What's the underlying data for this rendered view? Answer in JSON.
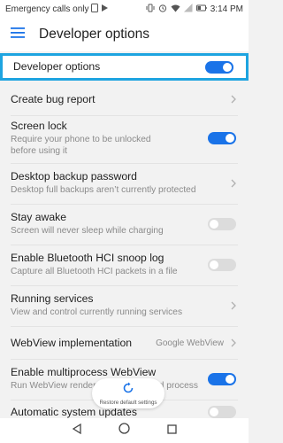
{
  "status_bar": {
    "left_text": "Emergency calls only",
    "battery_level": "35%",
    "time": "3:14 PM"
  },
  "app_bar": {
    "title": "Developer options",
    "menu_icon": "hamburger-menu-icon"
  },
  "rows": [
    {
      "title": "Developer options",
      "subtitle": "",
      "control": "toggle",
      "checked": true
    },
    {
      "title": "Create bug report",
      "subtitle": "",
      "control": "chevron"
    },
    {
      "title": "Screen lock",
      "subtitle": "Require your phone to be unlocked before using it",
      "control": "toggle",
      "checked": true
    },
    {
      "title": "Desktop backup password",
      "subtitle": "Desktop full backups aren’t currently protected",
      "control": "chevron"
    },
    {
      "title": "Stay awake",
      "subtitle": "Screen will never sleep while charging",
      "control": "toggle",
      "checked": false
    },
    {
      "title": "Enable Bluetooth HCI snoop log",
      "subtitle": "Capture all Bluetooth HCI packets in a file",
      "control": "toggle",
      "checked": false
    },
    {
      "title": "Running services",
      "subtitle": "View and control currently running services",
      "control": "chevron"
    },
    {
      "title": "WebView implementation",
      "subtitle": "",
      "value": "Google WebView",
      "control": "chevron"
    },
    {
      "title": "Enable multiprocess WebView",
      "subtitle": "Run WebView renderers in an isolated process",
      "control": "toggle",
      "checked": true
    },
    {
      "title": "Automatic system updates",
      "subtitle": "",
      "control": "toggle",
      "checked": false
    }
  ],
  "restore_button": {
    "label": "Restore default settings"
  },
  "colors": {
    "accent": "#1a73e8",
    "highlight_border": "#1ea4e0",
    "background": "#f2f2f2"
  }
}
